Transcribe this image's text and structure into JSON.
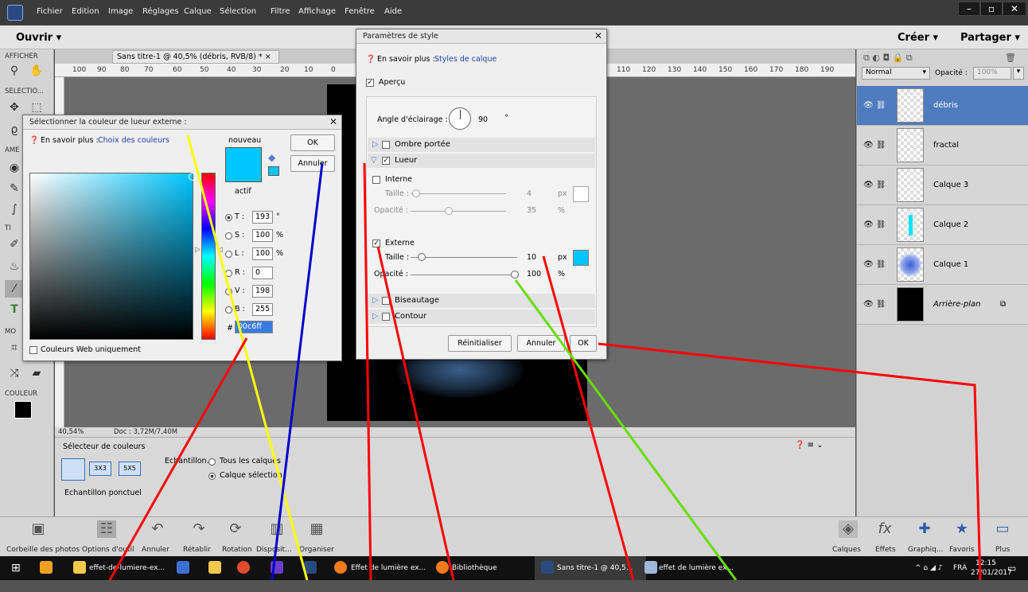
{
  "menubar": {
    "items": [
      "Fichier",
      "Edition",
      "Image",
      "Réglages",
      "Calque",
      "Sélection",
      "Filtre",
      "Affichage",
      "Fenêtre",
      "Aide"
    ]
  },
  "topbar": {
    "open": "Ouvrir",
    "create": "Créer",
    "share": "Partager"
  },
  "toolbox": {
    "afficher": "AFFICHER",
    "selection": "SELECTIO...",
    "ame": "AME",
    "mo": "MO",
    "couleur": "COULEUR",
    "tr": "TI"
  },
  "document": {
    "tab": "Sans titre-1 @ 40,5% (débris, RVB/8) *",
    "ruler": [
      "100",
      "90",
      "80",
      "70",
      "60",
      "50",
      "40",
      "30",
      "20",
      "10",
      "0",
      "110",
      "120",
      "130",
      "140",
      "150",
      "160",
      "170",
      "180",
      "190"
    ],
    "zoom": "40,54%",
    "doc_info": "Doc : 3,72M/7,40M"
  },
  "color_picker_panel": {
    "title": "Sélecteur de couleurs",
    "sample_label": "Echantillon. :",
    "opt_all": "Tous les calques",
    "opt_selected": "Calque sélection",
    "sizes": [
      "3X3",
      "5X5"
    ],
    "sample_mode": "Echantillon ponctuel"
  },
  "layers_panel": {
    "blend_mode": "Normal",
    "opacity_label": "Opacité :",
    "opacity_value": "100%",
    "layers": [
      {
        "name": "débris",
        "selected": true
      },
      {
        "name": "fractal"
      },
      {
        "name": "Calque 3"
      },
      {
        "name": "Calque 2"
      },
      {
        "name": "Calque 1"
      },
      {
        "name": "Arrière-plan"
      }
    ]
  },
  "bottom_strip": {
    "left": [
      "Corbeille des photos",
      "Options d'outil",
      "Annuler",
      "Rétablir",
      "Rotation",
      "Disposit...",
      "Organiser"
    ],
    "right": [
      "Calques",
      "Effets",
      "Graphiq...",
      "Favoris",
      "Plus"
    ]
  },
  "taskbar": {
    "items": [
      "effet-de-lumiere-ex...",
      "Effet de lumière ex...",
      "Bibliothèque",
      "Sans titre-1 @ 40,5...",
      "effet de lumière ex..."
    ],
    "lang": "FRA",
    "time": "12:15",
    "date": "27/01/2017"
  },
  "style_dialog": {
    "title": "Paramètres de style",
    "learn_more_prefix": "En savoir plus :",
    "learn_more_link": "Styles de calque",
    "preview": "Aperçu",
    "light_angle_label": "Angle d'éclairage :",
    "light_angle": "90",
    "degree": "°",
    "drop_shadow": "Ombre portée",
    "glow": "Lueur",
    "inner": "Interne",
    "size_label": "Taille :",
    "inner_size": "4",
    "px": "px",
    "opacity_label": "Opacité :",
    "inner_opacity": "35",
    "pct": "%",
    "outer": "Externe",
    "outer_size": "10",
    "outer_opacity": "100",
    "bevel": "Biseautage",
    "stroke": "Contour",
    "reset": "Réinitialiser",
    "cancel": "Annuler",
    "ok": "OK"
  },
  "color_dialog": {
    "title": "Sélectionner la couleur de lueur externe :",
    "learn_more_prefix": "En savoir plus :",
    "learn_more_link": "Choix des couleurs",
    "new_label": "nouveau",
    "current_label": "actif",
    "ok": "OK",
    "cancel": "Annuler",
    "t_label": "T :",
    "t_value": "193",
    "t_unit": "°",
    "s_label": "S :",
    "s_value": "100",
    "s_unit": "%",
    "l_label": "L :",
    "l_value": "100",
    "l_unit": "%",
    "r_label": "R :",
    "r_value": "0",
    "v_label": "V :",
    "v_value": "198",
    "b_label": "B :",
    "b_value": "255",
    "hash": "#",
    "hex": "00c6ff",
    "web_only": "Couleurs Web uniquement",
    "color": "#00c6ff"
  }
}
